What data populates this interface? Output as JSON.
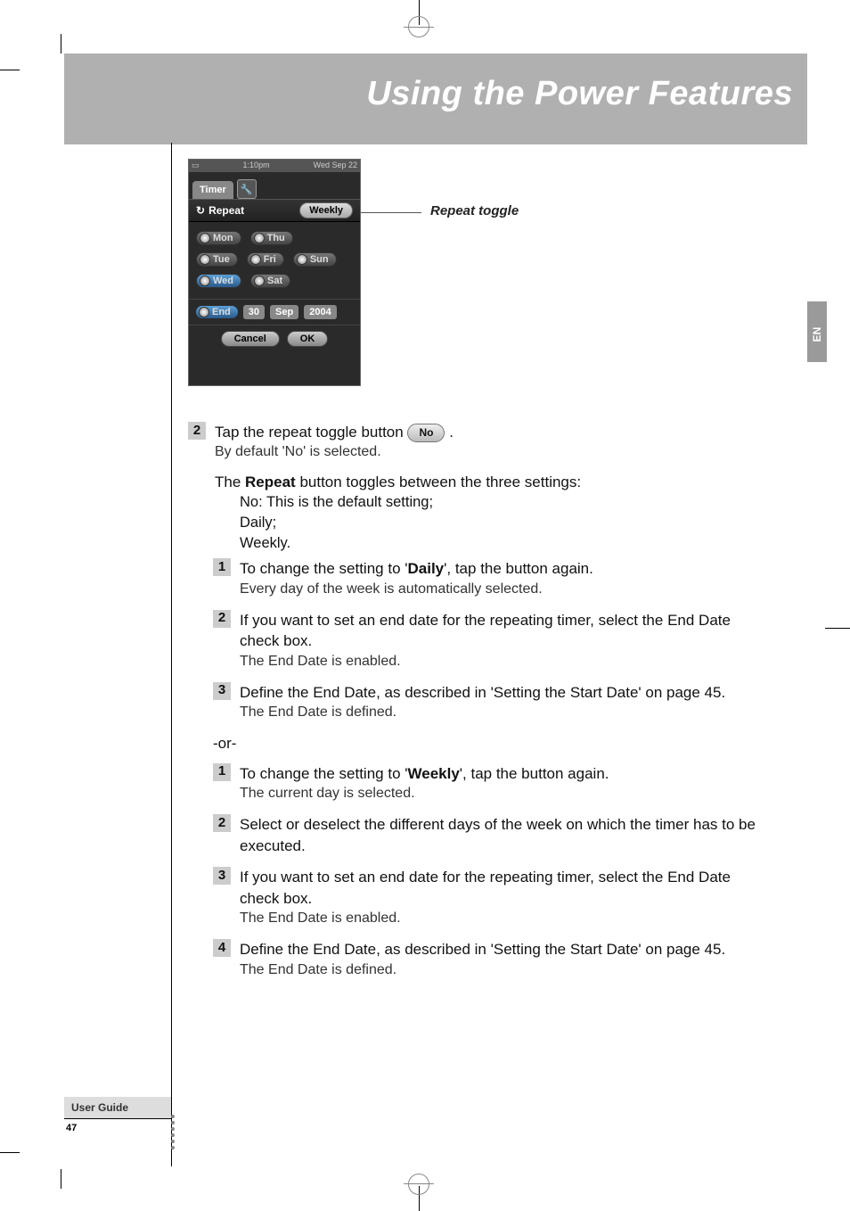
{
  "header": {
    "title": "Using the Power Features"
  },
  "side_tab": "EN",
  "phone": {
    "status_time": "1:10pm",
    "status_date": "Wed Sep 22",
    "tab_timer": "Timer",
    "repeat_label": "Repeat",
    "repeat_value": "Weekly",
    "days": {
      "mon": "Mon",
      "tue": "Tue",
      "wed": "Wed",
      "thu": "Thu",
      "fri": "Fri",
      "sat": "Sat",
      "sun": "Sun"
    },
    "end_label": "End",
    "end_day": "30",
    "end_month": "Sep",
    "end_year": "2004",
    "btn_cancel": "Cancel",
    "btn_ok": "OK"
  },
  "callout": {
    "repeat_toggle": "Repeat toggle"
  },
  "step2": {
    "text_a": "Tap the repeat toggle button ",
    "pill": "No",
    "text_b": ".",
    "sub": "By default 'No' is selected.",
    "repeat_line_a": "The ",
    "repeat_bold": "Repeat",
    "repeat_line_b": " button toggles between the three settings:",
    "opt1": "No: This is the default setting;",
    "opt2": "Daily;",
    "opt3": "Weekly."
  },
  "daily": {
    "s1_a": "To change the setting to '",
    "s1_bold": "Daily",
    "s1_b": "', tap the button again.",
    "s1_sub": "Every day of the week is automatically selected.",
    "s2": "If you want to set an end date for the repeating timer, select the End Date check box.",
    "s2_sub": "The End Date is enabled.",
    "s3": "Define the End Date, as described in 'Setting the Start Date' on page 45.",
    "s3_sub": "The End Date is defined."
  },
  "or": "-or-",
  "weekly": {
    "s1_a": "To change the setting to '",
    "s1_bold": "Weekly",
    "s1_b": "', tap the button again.",
    "s1_sub": "The current day is selected.",
    "s2": "Select or deselect the different days of the week on which the timer has to be executed.",
    "s3": "If you want to set an end date for the repeating timer, select the End Date check box.",
    "s3_sub": "The End Date is enabled.",
    "s4": "Define the End Date, as described in 'Setting the Start Date' on page 45.",
    "s4_sub": "The End Date is defined."
  },
  "nums": {
    "n1": "1",
    "n2": "2",
    "n3": "3",
    "n4": "4"
  },
  "footer": {
    "guide": "User Guide",
    "page": "47"
  }
}
